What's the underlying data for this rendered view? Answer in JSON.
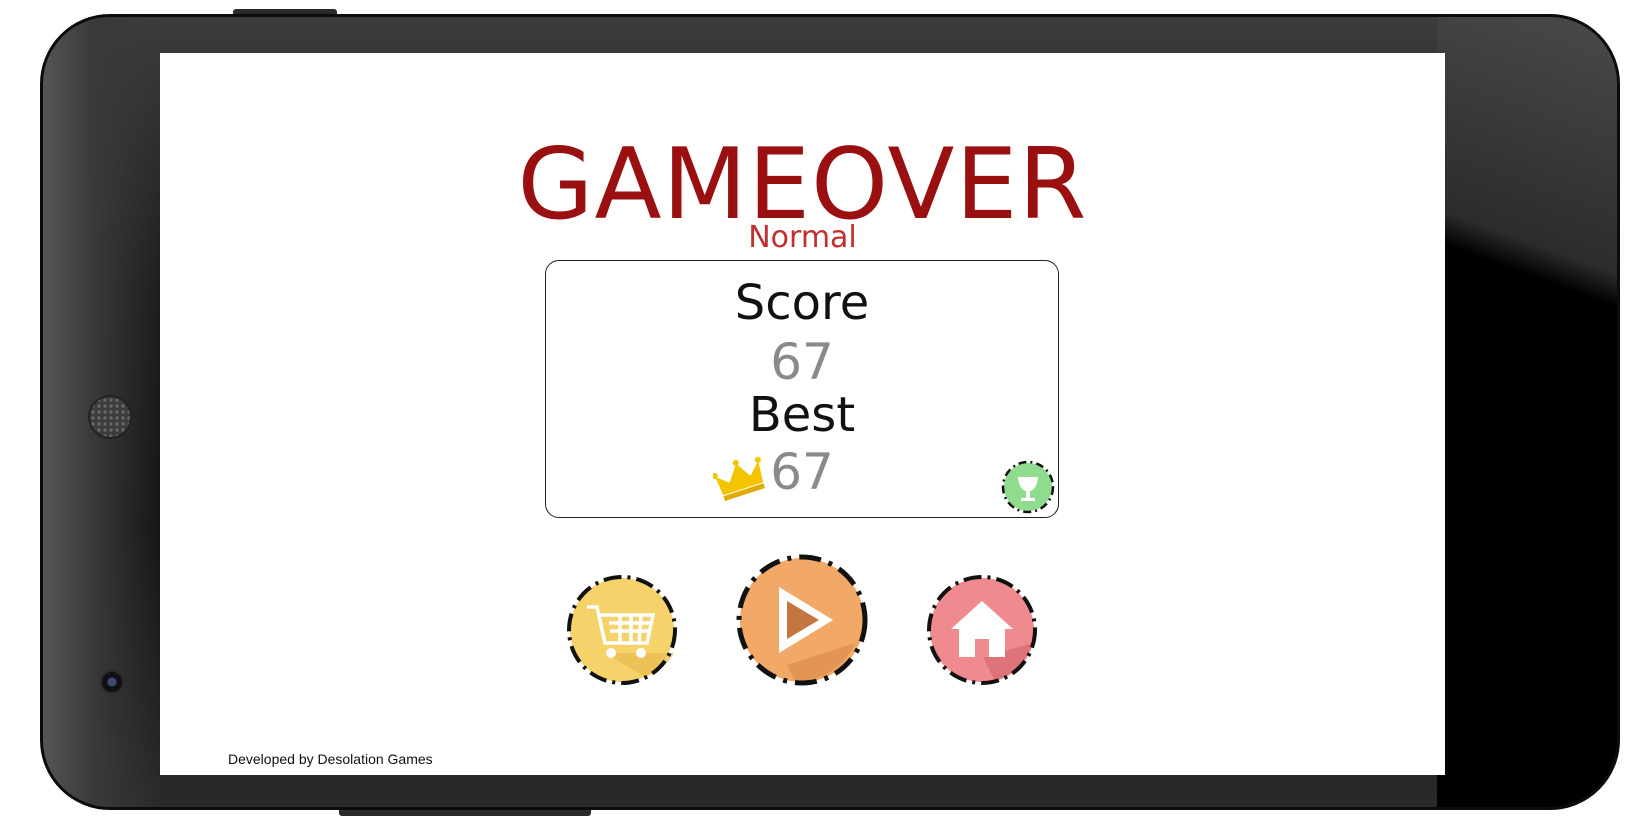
{
  "screen": {
    "title": "GAMEOVER",
    "mode": "Normal"
  },
  "score_panel": {
    "score_label": "Score",
    "score_value": "67",
    "best_label": "Best",
    "best_value": "67"
  },
  "buttons": [
    {
      "name": "shop",
      "icon": "shopping-cart-icon",
      "color": "#f5d36a"
    },
    {
      "name": "play",
      "icon": "play-icon",
      "color": "#f2a867"
    },
    {
      "name": "home",
      "icon": "home-icon",
      "color": "#ef8a8e"
    }
  ],
  "achievements": {
    "icon": "trophy-icon",
    "color": "#8fdc8f"
  },
  "footer": {
    "credits": "Developed by Desolation Games"
  },
  "colors": {
    "title": "#9a1010",
    "mode": "#c03030",
    "score_value": "#8a8a8a",
    "crown": "#f5c400"
  }
}
